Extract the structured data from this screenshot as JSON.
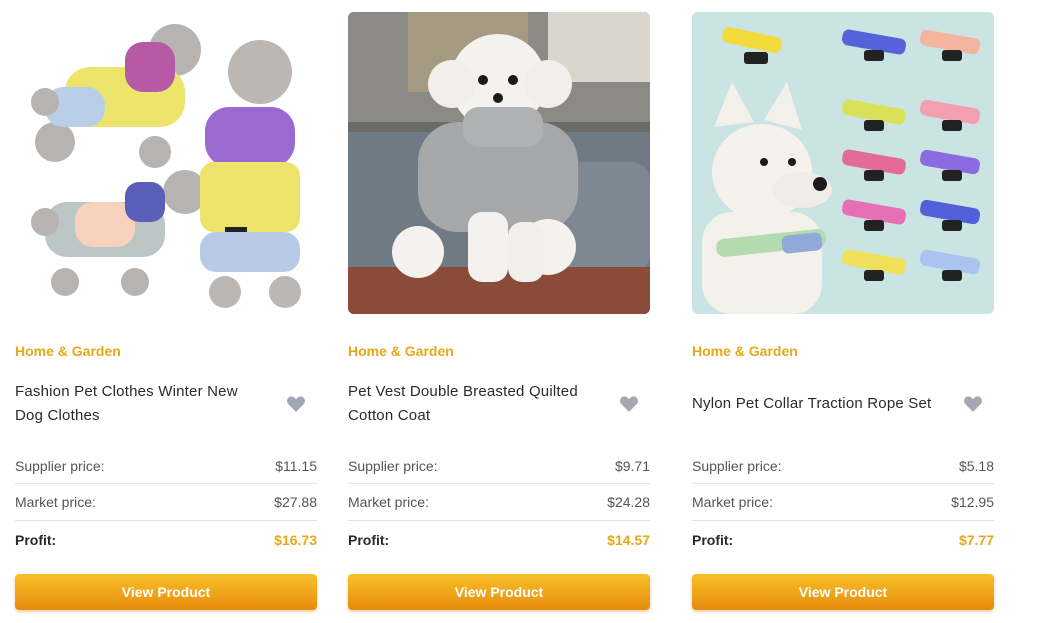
{
  "products": [
    {
      "category": "Home & Garden",
      "title": "Fashion Pet Clothes Winter New Dog Clothes",
      "image_desc": "grey poodles in pastel winter jackets",
      "supplier_label": "Supplier price:",
      "supplier_price": "$11.15",
      "market_label": "Market price:",
      "market_price": "$27.88",
      "profit_label": "Profit:",
      "profit": "$16.73",
      "button": "View Product"
    },
    {
      "category": "Home & Garden",
      "title": "Pet Vest Double Breasted Quilted Cotton Coat",
      "image_desc": "white fluffy dog in grey knit coat on sofa",
      "supplier_label": "Supplier price:",
      "supplier_price": "$9.71",
      "market_label": "Market price:",
      "market_price": "$24.28",
      "profit_label": "Profit:",
      "profit": "$14.57",
      "button": "View Product"
    },
    {
      "category": "Home & Garden",
      "title": "Nylon Pet Collar Traction Rope Set",
      "image_desc": "white dog with pastel collars",
      "supplier_label": "Supplier price:",
      "supplier_price": "$5.18",
      "market_label": "Market price:",
      "market_price": "$12.95",
      "profit_label": "Profit:",
      "profit": "$7.77",
      "button": "View Product"
    }
  ],
  "colors": {
    "accent": "#e6a817",
    "button_top": "#f6c02a",
    "button_bottom": "#e58a0f",
    "heart": "#a4a8b4"
  }
}
